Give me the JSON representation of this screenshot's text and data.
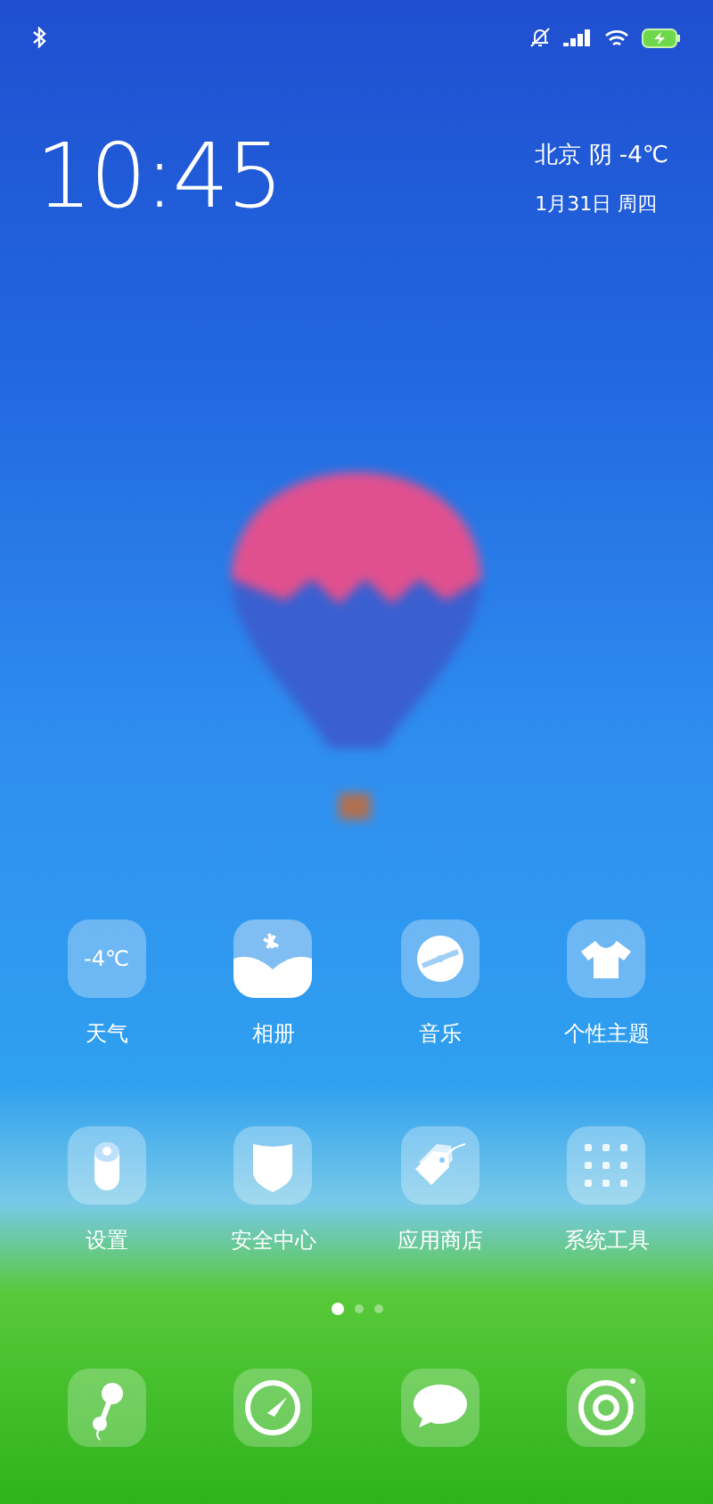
{
  "clock": {
    "time": "10:45"
  },
  "weather_widget": {
    "location_weather": "北京 阴 -4℃",
    "date": "1月31日 周四"
  },
  "apps": [
    {
      "kind": "weather",
      "label": "天气",
      "icon_text": "-4℃"
    },
    {
      "kind": "gallery",
      "label": "相册"
    },
    {
      "kind": "music",
      "label": "音乐"
    },
    {
      "kind": "themes",
      "label": "个性主题"
    },
    {
      "kind": "settings",
      "label": "设置"
    },
    {
      "kind": "security",
      "label": "安全中心"
    },
    {
      "kind": "store",
      "label": "应用商店"
    },
    {
      "kind": "folder",
      "label": "系统工具"
    }
  ],
  "page_dots": [
    {
      "selected": true
    },
    {
      "selected": false
    },
    {
      "selected": false
    }
  ],
  "dock": [
    {
      "kind": "phone"
    },
    {
      "kind": "browser"
    },
    {
      "kind": "messages"
    },
    {
      "kind": "camera"
    }
  ]
}
